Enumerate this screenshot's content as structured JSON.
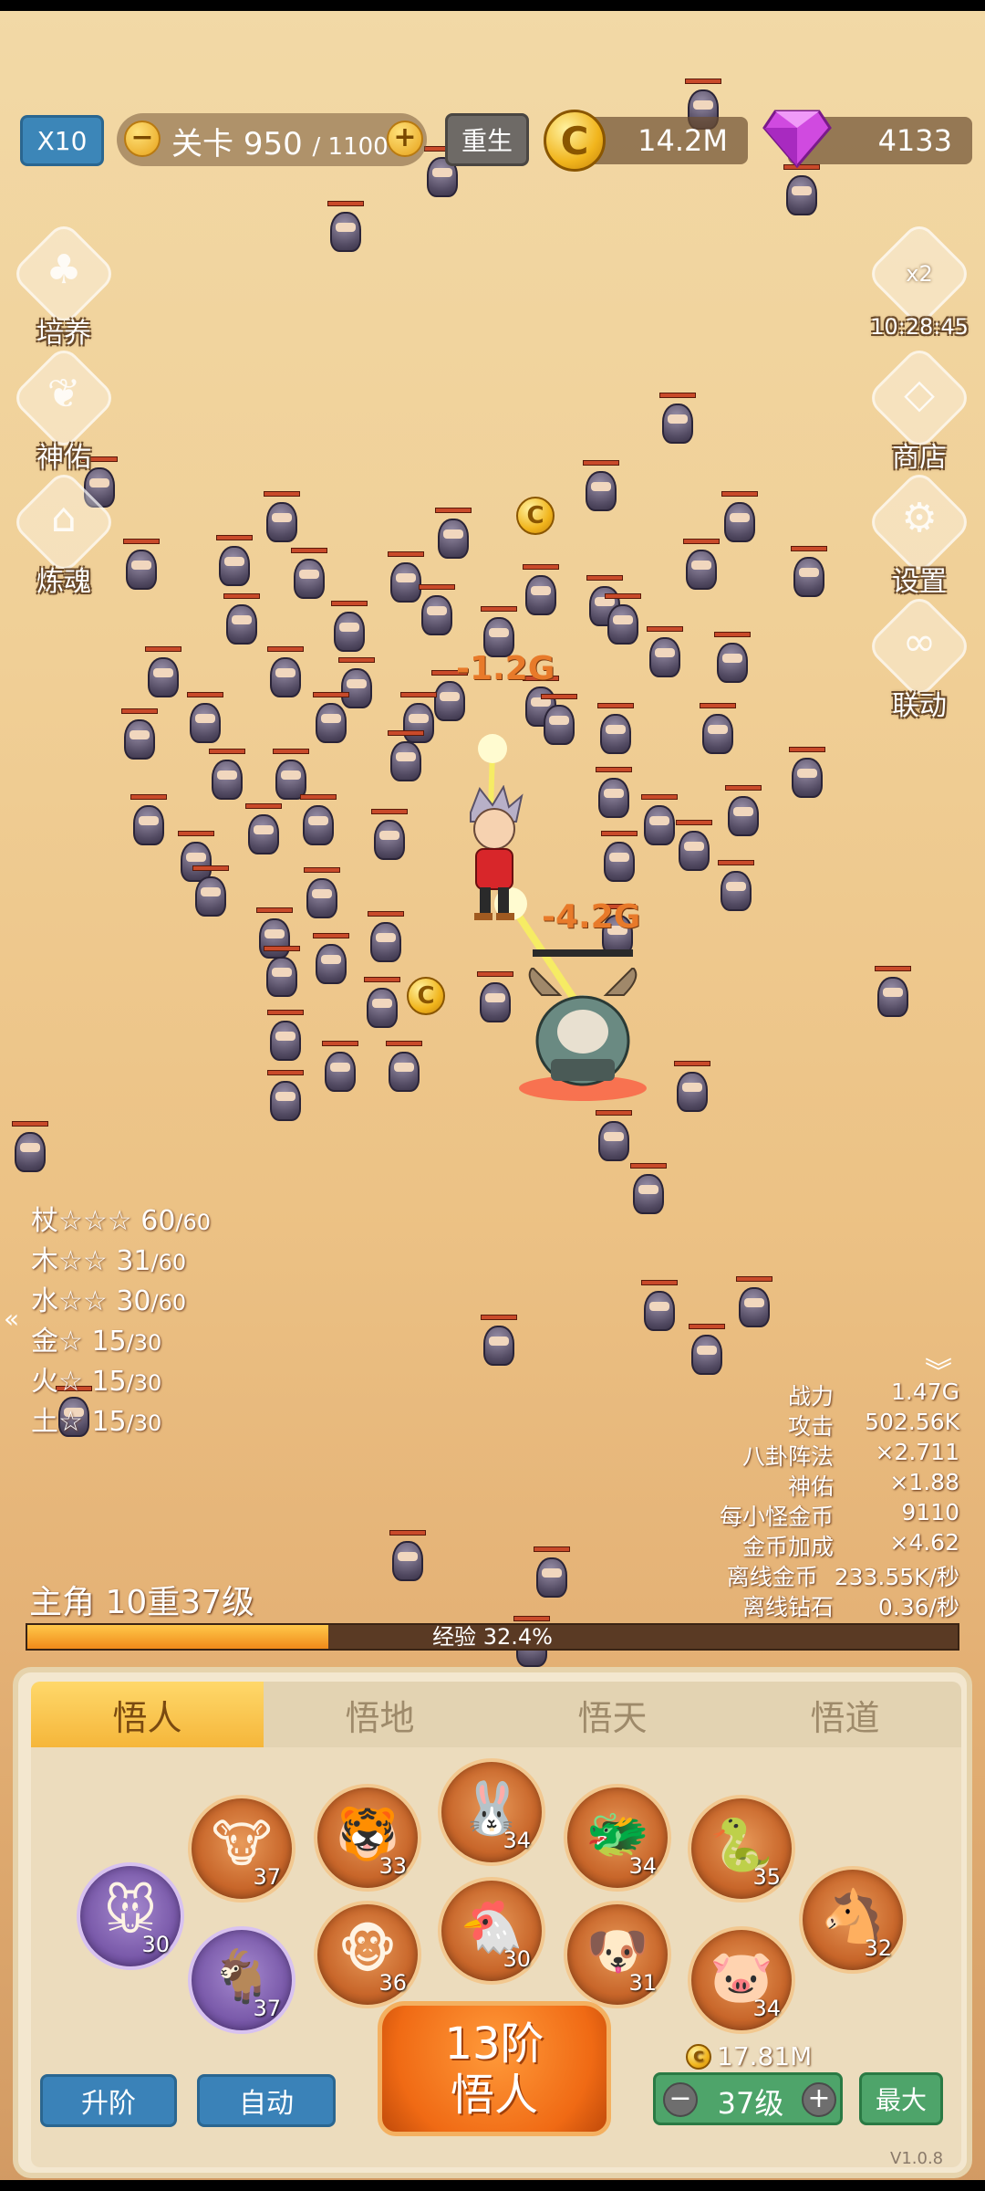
{
  "hud": {
    "speed_label": "X10",
    "stage_label": "关卡",
    "stage_current": "950",
    "stage_total": "/ 1100",
    "rebirth_label": "重生",
    "gold_amount": "14.2M",
    "gem_amount": "4133",
    "coin_symbol": "C"
  },
  "left_menu": {
    "cultivate": "培养",
    "blessing": "神佑",
    "soul": "炼魂"
  },
  "right_menu": {
    "boost_multiplier": "x2",
    "boost_timer": "10:28:45",
    "shop": "商店",
    "settings": "设置",
    "linkage": "联动"
  },
  "battle": {
    "damage_1": "-1.2G",
    "damage_2": "-4.2G"
  },
  "elements": [
    {
      "name": "杖",
      "stars": "☆☆☆",
      "value": "60",
      "max": "/60"
    },
    {
      "name": "木",
      "stars": "☆☆",
      "value": "31",
      "max": "/60"
    },
    {
      "name": "水",
      "stars": "☆☆",
      "value": "30",
      "max": "/60"
    },
    {
      "name": "金",
      "stars": "☆",
      "value": "15",
      "max": "/30"
    },
    {
      "name": "火",
      "stars": "☆",
      "value": "15",
      "max": "/30"
    },
    {
      "name": "土",
      "stars": "☆",
      "value": "15",
      "max": "/30"
    }
  ],
  "stats": [
    {
      "label": "战力",
      "value": "1.47G"
    },
    {
      "label": "攻击",
      "value": "502.56K"
    },
    {
      "label": "八卦阵法",
      "value": "×2.711"
    },
    {
      "label": "神佑",
      "value": "×1.88"
    },
    {
      "label": "每小怪金币",
      "value": "9110"
    },
    {
      "label": "金币加成",
      "value": "×4.62"
    },
    {
      "label": "离线金币",
      "value": "233.55K/秒"
    },
    {
      "label": "离线钻石",
      "value": "0.36/秒"
    }
  ],
  "hero": {
    "level_text": "主角 10重37级",
    "exp_label": "经验 32.4%",
    "exp_progress": 0.324
  },
  "tabs": [
    "悟人",
    "悟地",
    "悟天",
    "悟道"
  ],
  "zodiac": [
    {
      "icon": "rat-icon",
      "glyph": "🐭",
      "level": "30",
      "selected": true
    },
    {
      "icon": "ox-icon",
      "glyph": "🐮",
      "level": "37",
      "selected": false
    },
    {
      "icon": "tiger-icon",
      "glyph": "🐯",
      "level": "33",
      "selected": false
    },
    {
      "icon": "rabbit-icon",
      "glyph": "🐰",
      "level": "34",
      "selected": false
    },
    {
      "icon": "dragon-icon",
      "glyph": "🐲",
      "level": "34",
      "selected": false
    },
    {
      "icon": "snake-icon",
      "glyph": "🐍",
      "level": "35",
      "selected": false
    },
    {
      "icon": "horse-icon",
      "glyph": "🐴",
      "level": "32",
      "selected": false
    },
    {
      "icon": "goat-icon",
      "glyph": "🐐",
      "level": "37",
      "selected": true
    },
    {
      "icon": "monkey-icon",
      "glyph": "🐵",
      "level": "36",
      "selected": false
    },
    {
      "icon": "rooster-icon",
      "glyph": "🐔",
      "level": "30",
      "selected": false
    },
    {
      "icon": "dog-icon",
      "glyph": "🐶",
      "level": "31",
      "selected": false
    },
    {
      "icon": "pig-icon",
      "glyph": "🐷",
      "level": "34",
      "selected": false
    }
  ],
  "actions": {
    "upgrade_tier": "升阶",
    "auto": "自动",
    "main_line1": "13阶",
    "main_line2": "悟人",
    "cost": "17.81M",
    "level_value": "37级",
    "max": "最大",
    "minus": "−",
    "plus": "+"
  },
  "version": "V1.0.8",
  "colors": {
    "accent_orange": "#f06a14",
    "button_blue": "#3a82b8",
    "button_green": "#4ea46a",
    "exp_fill": "#f08a1a"
  }
}
